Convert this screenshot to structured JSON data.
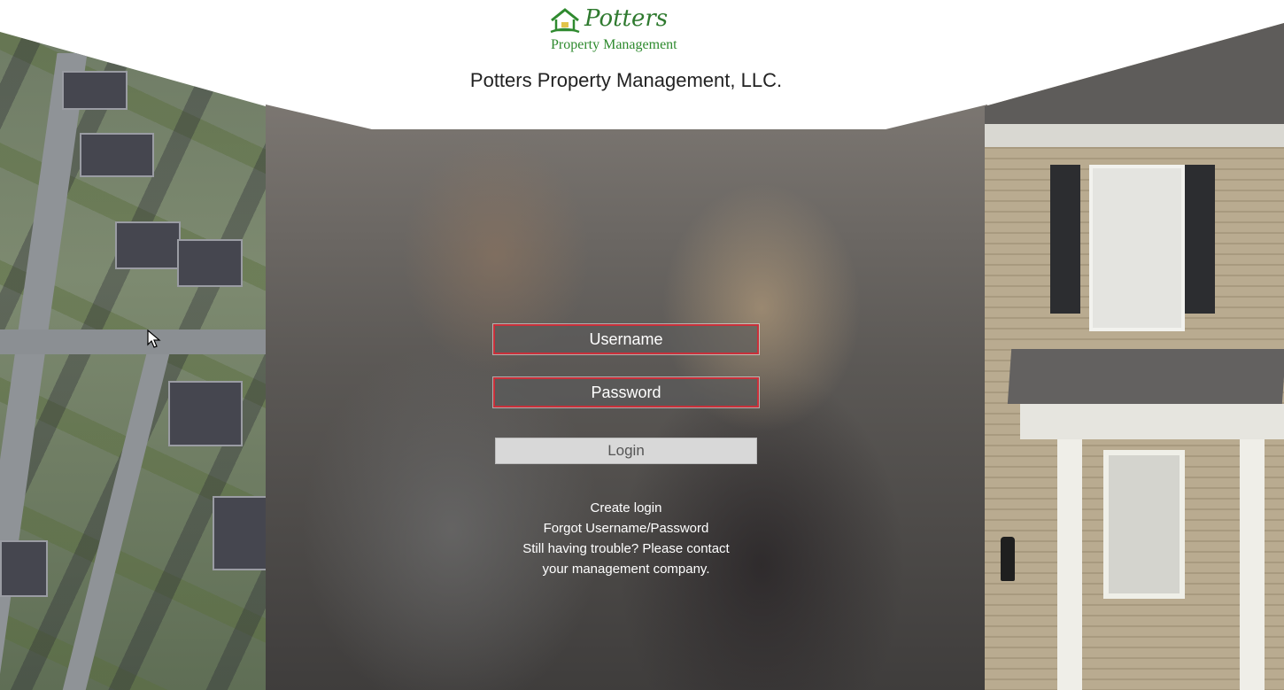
{
  "header": {
    "logo_script": "Potters",
    "logo_sub": "Property Management",
    "company_name": "Potters Property Management, LLC."
  },
  "form": {
    "username_placeholder": "Username",
    "password_placeholder": "Password",
    "login_label": "Login"
  },
  "links": {
    "create_login": "Create login",
    "forgot": "Forgot Username/Password",
    "trouble_line1": "Still having trouble? Please contact",
    "trouble_line2": "your management company."
  },
  "colors": {
    "brand_green": "#2f7a2f",
    "field_border": "#c9303a"
  },
  "icons": [
    "house-logo-icon",
    "mouse-cursor-icon"
  ]
}
